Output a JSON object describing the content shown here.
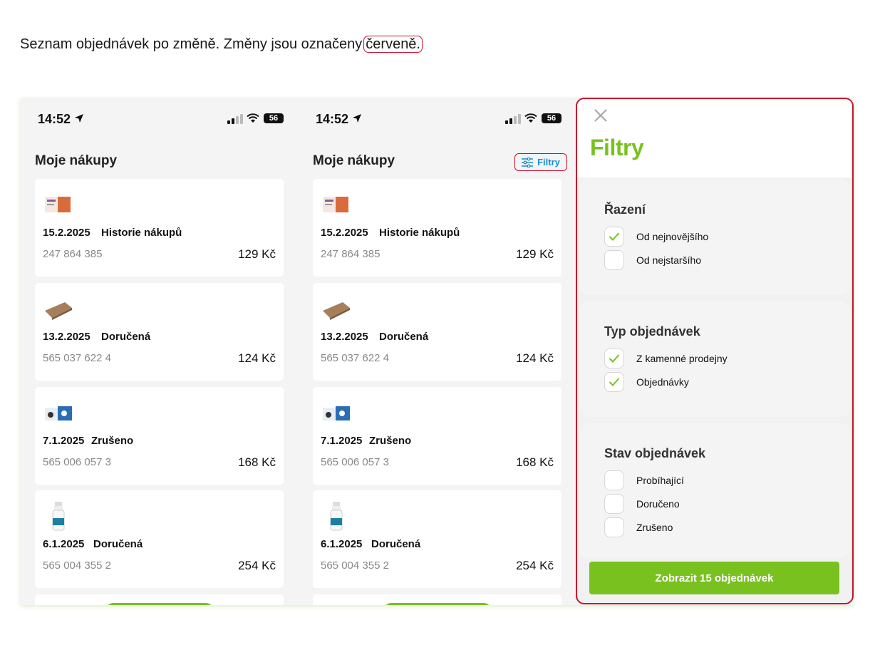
{
  "caption": {
    "text": "Seznam objednávek po změně. Změny jsou označeny",
    "highlight": "červeně."
  },
  "status_bar": {
    "time": "14:52",
    "battery": "56"
  },
  "phones": [
    {
      "title": "Moje nákupy",
      "orders": [
        {
          "date": "15.2.2025",
          "state": "Historie nákupů",
          "number": "247 864 385",
          "price": "129 Kč",
          "icon": "supplement-box-icon"
        },
        {
          "date": "13.2.2025",
          "state": "Doručená",
          "number": "565 037 622 4",
          "price": "124 Kč",
          "icon": "scratcher-pad-icon"
        },
        {
          "date": "7.1.2025",
          "state": "Zrušeno",
          "number": "565 006 057 3",
          "price": "168 Kč",
          "icon": "pet-food-pack-icon"
        },
        {
          "date": "6.1.2025",
          "state": "Doručená",
          "number": "565 004 355 2",
          "price": "254 Kč",
          "icon": "spray-bottle-icon"
        }
      ]
    },
    {
      "title": "Moje nákupy",
      "filter_label": "Filtry",
      "orders": [
        {
          "date": "15.2.2025",
          "state": "Historie nákupů",
          "number": "247 864 385",
          "price": "129 Kč",
          "icon": "supplement-box-icon"
        },
        {
          "date": "13.2.2025",
          "state": "Doručená",
          "number": "565 037 622 4",
          "price": "124 Kč",
          "icon": "scratcher-pad-icon"
        },
        {
          "date": "7.1.2025",
          "state": "Zrušeno",
          "number": "565 006 057 3",
          "price": "168 Kč",
          "icon": "pet-food-pack-icon"
        },
        {
          "date": "6.1.2025",
          "state": "Doručená",
          "number": "565 004 355 2",
          "price": "254 Kč",
          "icon": "spray-bottle-icon"
        }
      ]
    }
  ],
  "filters": {
    "title": "Filtry",
    "sections": [
      {
        "title": "Řazení",
        "options": [
          {
            "label": "Od nejnovějšího",
            "checked": true
          },
          {
            "label": "Od nejstaršího",
            "checked": false
          }
        ]
      },
      {
        "title": "Typ objednávek",
        "options": [
          {
            "label": "Z kamenné prodejny",
            "checked": true
          },
          {
            "label": "Objednávky",
            "checked": true
          }
        ]
      },
      {
        "title": "Stav objednávek",
        "options": [
          {
            "label": "Probíhající",
            "checked": false
          },
          {
            "label": "Doručeno",
            "checked": false
          },
          {
            "label": "Zrušeno",
            "checked": false
          }
        ]
      }
    ],
    "submit_label": "Zobrazit 15 objednávek"
  },
  "colors": {
    "accent_green": "#79c11f",
    "highlight_red": "#c8102e",
    "filter_blue": "#1a8fd0"
  }
}
